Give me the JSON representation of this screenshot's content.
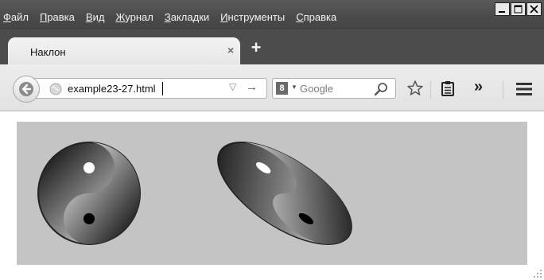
{
  "menu": {
    "items": [
      {
        "accel": "Ф",
        "rest": "айл"
      },
      {
        "accel": "П",
        "rest": "равка"
      },
      {
        "accel": "В",
        "rest": "ид"
      },
      {
        "accel": "Ж",
        "rest": "урнал"
      },
      {
        "accel": "З",
        "rest": "акладки"
      },
      {
        "accel": "И",
        "rest": "нструменты"
      },
      {
        "accel": "С",
        "rest": "правка"
      }
    ]
  },
  "tab": {
    "title": "Наклон",
    "close_glyph": "×"
  },
  "new_tab_glyph": "+",
  "address": {
    "url": "example23-27.html",
    "dropdown_glyph": "▽",
    "go_glyph": "→"
  },
  "search": {
    "engine_badge": "8",
    "placeholder": "Google",
    "engine_arrow": "▼"
  },
  "toolbar": {
    "overflow_glyph": "»"
  },
  "colors": {
    "stage_bg": "#c4c4c4",
    "chrome_dark": "#4a4a4a",
    "toolbar_bg": "#e6e6e6"
  },
  "icons": [
    "back-arrow-icon",
    "globe-icon",
    "search-icon",
    "star-icon",
    "reading-list-icon",
    "overflow-icon",
    "hamburger-menu-icon",
    "minimize-icon",
    "maximize-icon",
    "close-icon"
  ],
  "content": {
    "figures": [
      {
        "name": "yin-yang-original",
        "skew_deg": 0
      },
      {
        "name": "yin-yang-skewed",
        "skew_deg": 30
      }
    ]
  }
}
